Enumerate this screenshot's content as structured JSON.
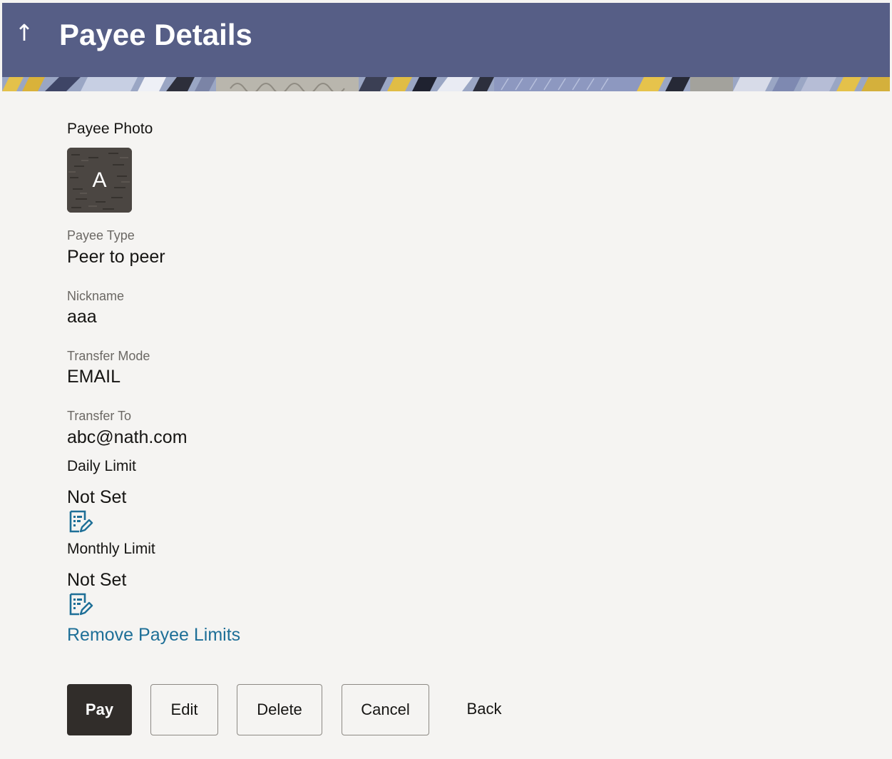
{
  "header": {
    "title": "Payee Details",
    "back_icon": "arrow-up-icon"
  },
  "payee": {
    "photo_label": "Payee Photo",
    "photo_initial": "A",
    "type_label": "Payee Type",
    "type_value": "Peer to peer",
    "nickname_label": "Nickname",
    "nickname_value": "aaa",
    "transfer_mode_label": "Transfer Mode",
    "transfer_mode_value": "EMAIL",
    "transfer_to_label": "Transfer To",
    "transfer_to_value": "abc@nath.com"
  },
  "limits": {
    "daily_label": "Daily Limit",
    "daily_value": "Not Set",
    "monthly_label": "Monthly Limit",
    "monthly_value": "Not Set",
    "edit_icon": "edit-limit-icon",
    "remove_link": "Remove Payee Limits"
  },
  "actions": {
    "pay": "Pay",
    "edit": "Edit",
    "delete": "Delete",
    "cancel": "Cancel",
    "back": "Back"
  },
  "colors": {
    "header_bg": "#565e86",
    "primary_button": "#312d2a",
    "link": "#1e6f97",
    "page_bg": "#f5f4f2"
  }
}
